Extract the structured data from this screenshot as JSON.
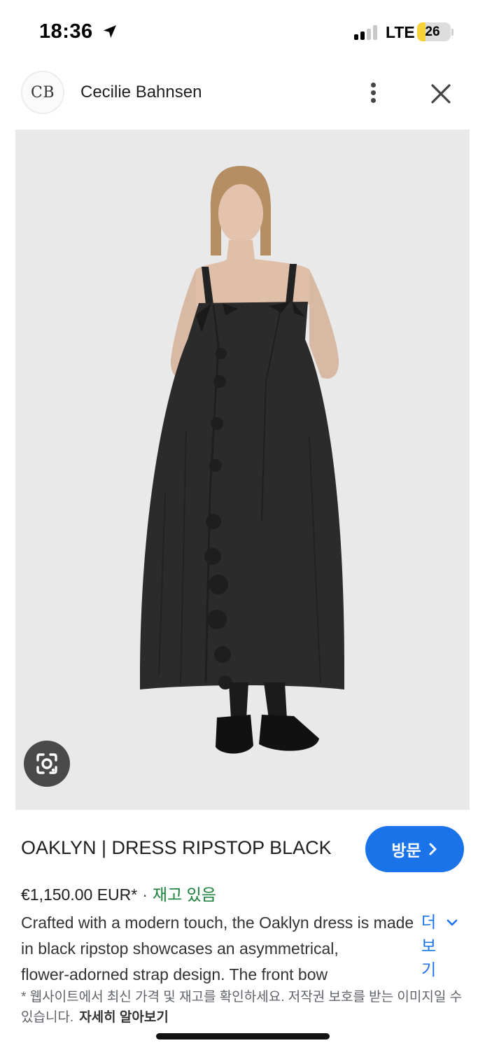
{
  "status_bar": {
    "time": "18:36",
    "network": "LTE",
    "battery": "26",
    "battery_level": 0.26,
    "signal_bars_active": 2,
    "signal_bars_total": 4,
    "icons": [
      "location-arrow-icon",
      "signal-icon",
      "battery-icon"
    ]
  },
  "header": {
    "logo_text": "CB",
    "site_name": "Cecilie Bahnsen",
    "icons": [
      "more-vert-icon",
      "close-icon"
    ]
  },
  "image": {
    "icons": [
      "google-lens-icon"
    ]
  },
  "product": {
    "title": "OAKLYN | DRESS RIPSTOP BLACK",
    "visit_label": "방문",
    "price": "€1,150.00 EUR*",
    "separator": "·",
    "availability": "재고 있음",
    "description_lines": [
      "Crafted with a modern touch, the Oaklyn dress is made",
      "in black ripstop showcases an asymmetrical,",
      "flower-adorned strap design. The front bow"
    ],
    "more_label": "더 보기",
    "disclaimer": "* 웹사이트에서 최신 가격 및 재고를 확인하세요. 저작권 보호를 받는 이미지일 수 있습니다.",
    "learn_more": "자세히 알아보기"
  },
  "colors": {
    "accent": "#1a73e8",
    "in_stock": "#188038",
    "battery_fill": "#f7d33a",
    "image_bg": "#e9e9e9"
  }
}
